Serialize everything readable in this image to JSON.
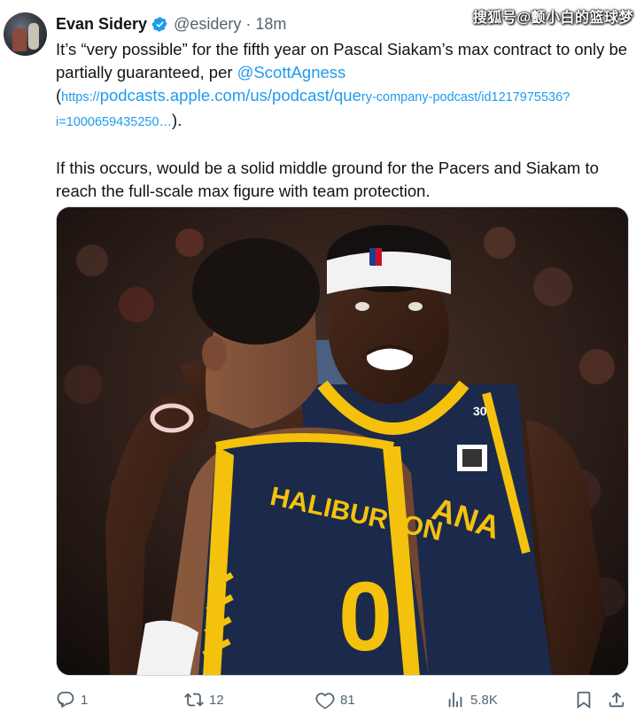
{
  "author": {
    "name": "Evan Sidery",
    "handle": "@esidery",
    "separator": "·",
    "time": "18m"
  },
  "watermark": "搜狐号@颤小白的篮球梦",
  "tweet": {
    "line1_before": "It’s “very possible” for the fifth year on Pascal Siakam’s max contract to only be partially guaranteed, per ",
    "mention": "@ScottAgness",
    "paren_open": "(",
    "link_part1": "https://",
    "link_part2": "podcasts.apple.com/us/podcast/que",
    "link_part3": "ry-company-podcast/id1217975536?i=1000659435250…",
    "paren_close": ").",
    "paragraph2": "If this occurs, would be a solid middle ground for the Pacers and Siakam to reach the full-scale max figure with team protection."
  },
  "media": {
    "jersey_front": "HALIBURTON",
    "jersey_front_number": "0",
    "jersey_back_text": "ANA",
    "jersey_back_number": "30"
  },
  "actions": {
    "replies": "1",
    "reposts": "12",
    "likes": "81",
    "views": "5.8K"
  },
  "colors": {
    "link": "#1d9bf0",
    "muted": "#536471",
    "pacers_navy": "#1b2a4a",
    "pacers_gold": "#f4c20d"
  }
}
